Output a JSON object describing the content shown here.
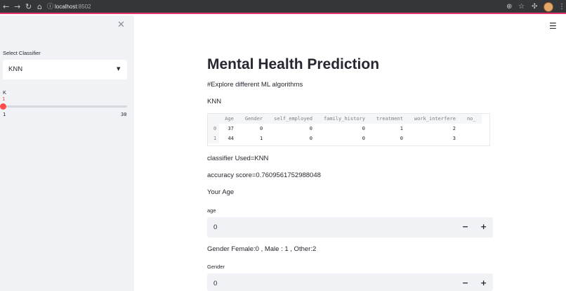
{
  "browser": {
    "url_host": "localhost",
    "url_port": ":8502"
  },
  "sidebar": {
    "classifier_label": "Select Classifier",
    "classifier_value": "KNN",
    "k_label": "K",
    "k_value": "1",
    "k_min": "1",
    "k_max": "30"
  },
  "main": {
    "title": "Mental Health Prediction",
    "subtitle": "#Explore different ML algorithms",
    "classifier_name": "KNN",
    "dataframe": {
      "columns": [
        "",
        "Age",
        "Gender",
        "self_employed",
        "family_history",
        "treatment",
        "work_interfere",
        "no_"
      ],
      "rows": [
        [
          "0",
          "37",
          "0",
          "0",
          "0",
          "1",
          "2",
          ""
        ],
        [
          "1",
          "44",
          "1",
          "0",
          "0",
          "0",
          "3",
          ""
        ]
      ]
    },
    "classifier_used": "classifier Used=KNN",
    "accuracy": "accuracy score=0.7609561752988048",
    "your_age": "Your Age",
    "age_label": "age",
    "age_value": "0",
    "gender_hint": "Gender Female:0 , Male : 1 , Other:2",
    "gender_label": "Gender",
    "gender_value": "0",
    "minus": "−",
    "plus": "+"
  },
  "colors": {
    "accent": "#ff4b4b",
    "sidebar_bg": "#f0f2f6",
    "browser_bar": "#35363a"
  }
}
